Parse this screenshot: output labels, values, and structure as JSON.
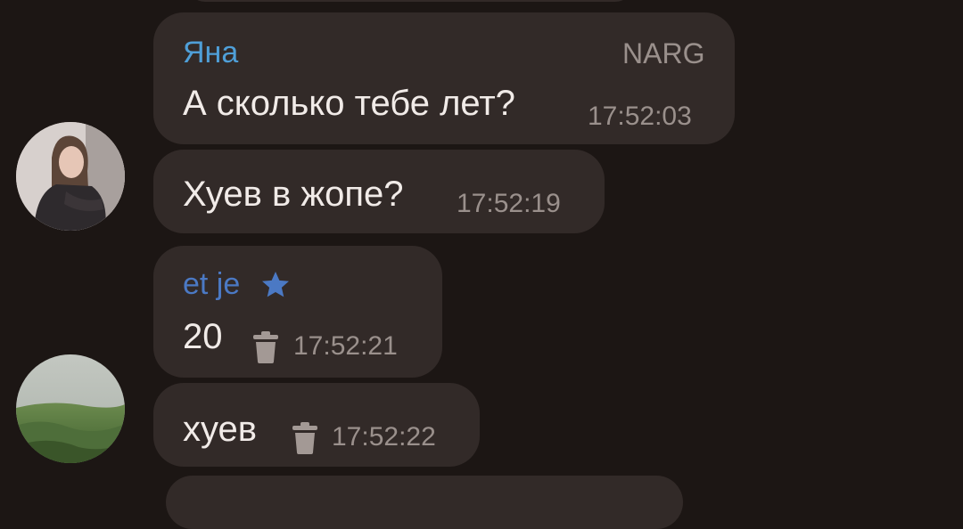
{
  "messages": [
    {
      "sender": "Яна",
      "sender_color": "#4f9fd8",
      "tag": "NARG",
      "text": "А сколько тебе лет?",
      "time": "17:52:03"
    },
    {
      "text": "Хуев в жопе?",
      "time": "17:52:19"
    },
    {
      "sender": "et je",
      "sender_color": "#4b79c4",
      "sender_icon": "star-icon",
      "text": "20",
      "icon": "trash-icon",
      "time": "17:52:21"
    },
    {
      "text": "хуев",
      "icon": "trash-icon",
      "time": "17:52:22"
    }
  ],
  "avatars": [
    "avatar-girl-photo",
    "avatar-landscape-photo"
  ]
}
